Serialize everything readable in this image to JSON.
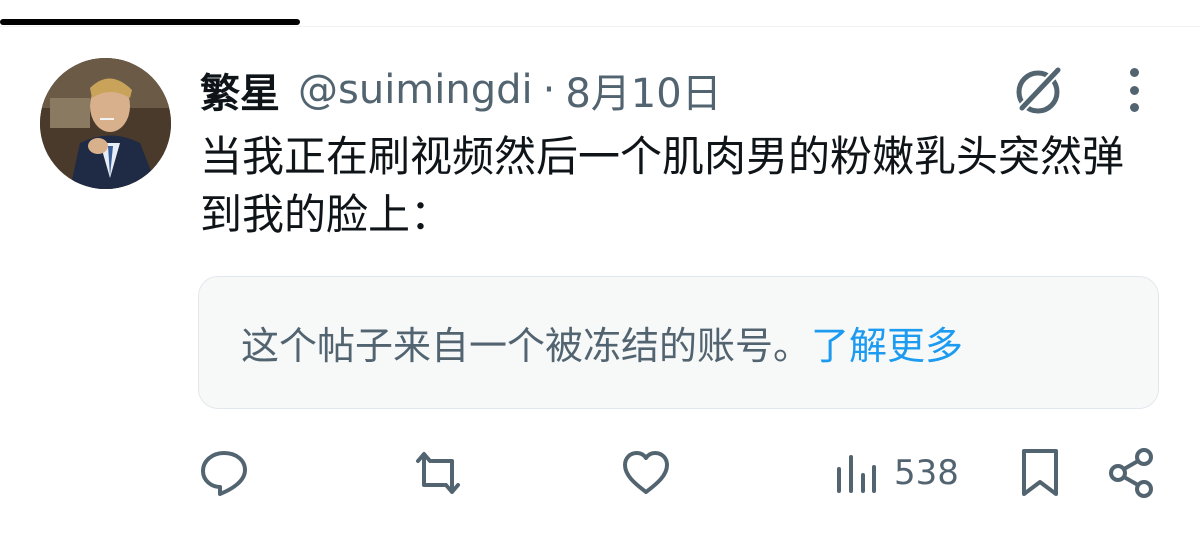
{
  "author": {
    "name": "繁星",
    "handle": "@suimingdi",
    "separator": "·",
    "date": "8月10日"
  },
  "post": {
    "text": "当我正在刷视频然后一个肌肉男的粉嫩乳头突然弹到我的脸上："
  },
  "notice": {
    "message": "这个帖子来自一个被冻结的账号。",
    "link_label": "了解更多"
  },
  "actions": {
    "views_count": "538"
  },
  "icons": {
    "reply": "reply-icon",
    "repost": "repost-icon",
    "like": "like-icon",
    "views": "views-icon",
    "bookmark": "bookmark-icon",
    "share": "share-icon",
    "grok": "grok-icon",
    "more": "more-icon"
  },
  "colors": {
    "text": "#0f1419",
    "secondary": "#536471",
    "link": "#1d9bf0",
    "notice_bg": "#f7f9f9"
  }
}
